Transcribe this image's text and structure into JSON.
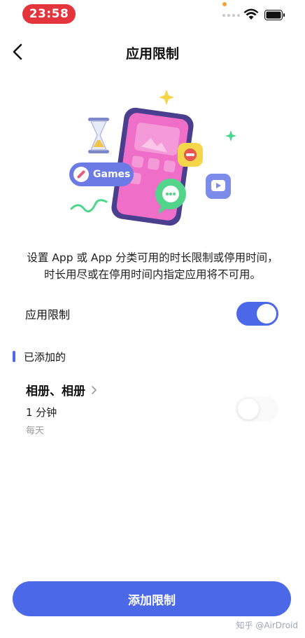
{
  "status_bar": {
    "time": "23:58"
  },
  "nav": {
    "title": "应用限制",
    "back_icon": "chevron-left-icon"
  },
  "illustration": {
    "badge_label": "Games"
  },
  "description": {
    "line1": "设置 App 或 App 分类可用的时长限制或停用时间，",
    "line2": "时长用尽或在停用时间内指定应用将不可用。"
  },
  "setting": {
    "label": "应用限制",
    "enabled": true
  },
  "section": {
    "title": "已添加的"
  },
  "limit_card": {
    "title": "相册、相册",
    "duration": "1 分钟",
    "frequency": "每天",
    "enabled": false
  },
  "footer": {
    "add_button_label": "添加限制"
  },
  "watermark": {
    "text": "知乎 @AirDroid"
  },
  "colors": {
    "accent": "#4b68e8",
    "time_pill": "#e4353c",
    "phone_body": "#ef6fc8",
    "phone_frame": "#4a3f8f"
  }
}
